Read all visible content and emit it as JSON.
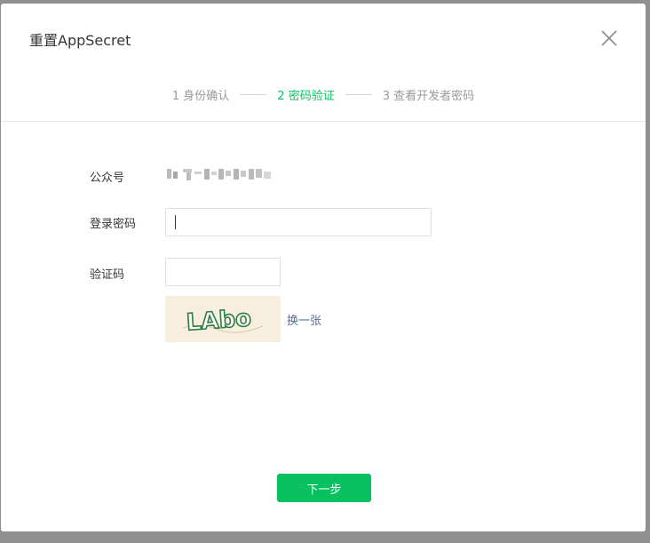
{
  "dialog": {
    "title": "重置AppSecret",
    "close_icon": "close-icon"
  },
  "steps": [
    {
      "label": "1 身份确认",
      "active": false
    },
    {
      "label": "2 密码验证",
      "active": true
    },
    {
      "label": "3 查看开发者密码",
      "active": false
    }
  ],
  "form": {
    "account_label": "公众号",
    "password_label": "登录密码",
    "password_value": "",
    "code_label": "验证码",
    "code_value": "",
    "captcha_text": "LAbo",
    "refresh_label": "换一张"
  },
  "footer": {
    "next_label": "下一步"
  },
  "colors": {
    "accent": "#07c160",
    "link": "#576b95"
  }
}
